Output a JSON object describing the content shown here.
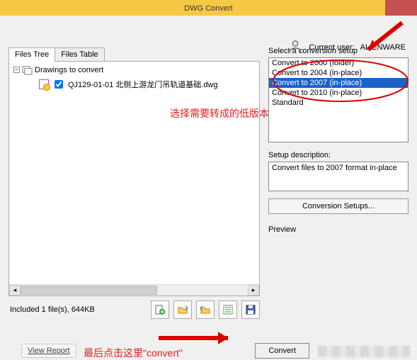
{
  "window": {
    "title": "DWG Convert"
  },
  "user": {
    "label": "Current user:",
    "name": "ALIENWARE"
  },
  "tabs": {
    "tree": "Files Tree",
    "table": "Files Table"
  },
  "tree": {
    "root": "Drawings to convert",
    "file": "QJ129-01-01 北侧上游龙门吊轨道基础.dwg"
  },
  "status": {
    "text": "Included 1 file(s), 644KB"
  },
  "setup": {
    "label": "Select a conversion setup",
    "options": [
      "Convert to 2000 (folder)",
      "Convert to 2004 (in-place)",
      "Convert to 2007 (in-place)",
      "Convert to 2010 (in-place)",
      "Standard"
    ],
    "selected_index": 2
  },
  "desc": {
    "label": "Setup description:",
    "text": "Convert files to 2007 format in-place"
  },
  "buttons": {
    "conversion_setups": "Conversion Setups...",
    "view_report": "View Report",
    "convert": "Convert"
  },
  "preview": {
    "label": "Preview"
  },
  "annotations": {
    "select_low_version": "选择需要转成的低版本",
    "click_convert": "最后点击这里\"convert\""
  }
}
